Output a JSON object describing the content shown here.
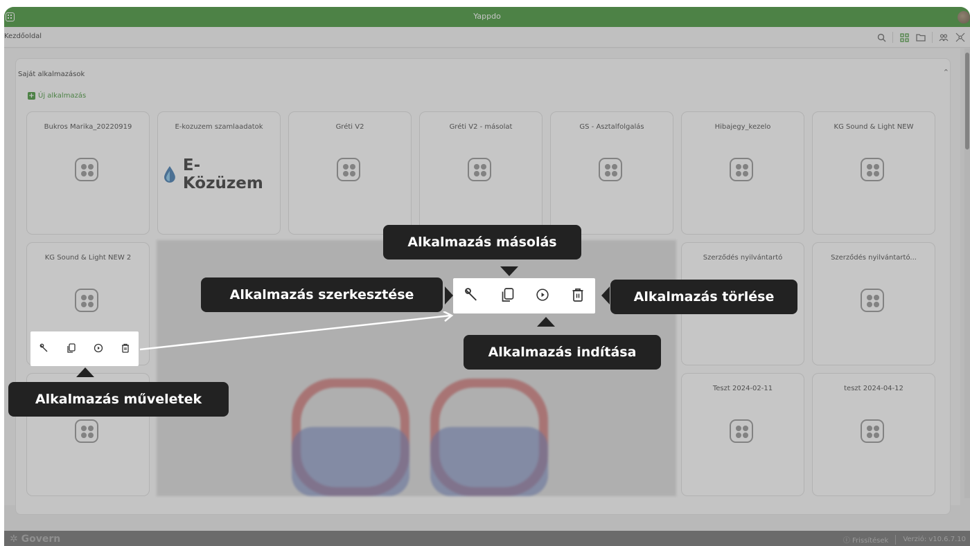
{
  "window": {
    "title": "Yappdo"
  },
  "breadcrumb": {
    "label": "Kezdőoldal"
  },
  "toolbar": {
    "icons": [
      "search-icon",
      "grid-view-icon",
      "folder-icon",
      "users-icon",
      "network-icon"
    ]
  },
  "panel": {
    "title": "Saját alkalmazások",
    "new_app_label": "Új alkalmazás"
  },
  "apps": [
    {
      "name": "Bukros Marika_20220919"
    },
    {
      "name": "E-kozuzem szamlaadatok",
      "logo_text": "E-Közüzem"
    },
    {
      "name": "Gréti V2"
    },
    {
      "name": "Gréti V2 - másolat"
    },
    {
      "name": "GS - Asztalfolgalás"
    },
    {
      "name": "Hibajegy_kezelo"
    },
    {
      "name": "KG Sound & Light NEW"
    },
    {
      "name": "KG Sound & Light NEW 2"
    },
    {
      "name": "Szerződés nyilvántartó"
    },
    {
      "name": "Szerződés nyilvántartó..."
    },
    {
      "name": "Teszt 2024-02-11"
    },
    {
      "name": "teszt 2024-04-12"
    }
  ],
  "callouts": {
    "copy": "Alkalmazás másolás",
    "edit": "Alkalmazás szerkesztése",
    "delete": "Alkalmazás törlése",
    "start": "Alkalmazás indítása",
    "actions": "Alkalmazás műveletek"
  },
  "status": {
    "brand": "Govern",
    "updates": "Frissítések",
    "version": "Verzió: v10.6.7.10"
  },
  "colors": {
    "accent": "#2f8a24",
    "callout_bg": "#222222"
  }
}
